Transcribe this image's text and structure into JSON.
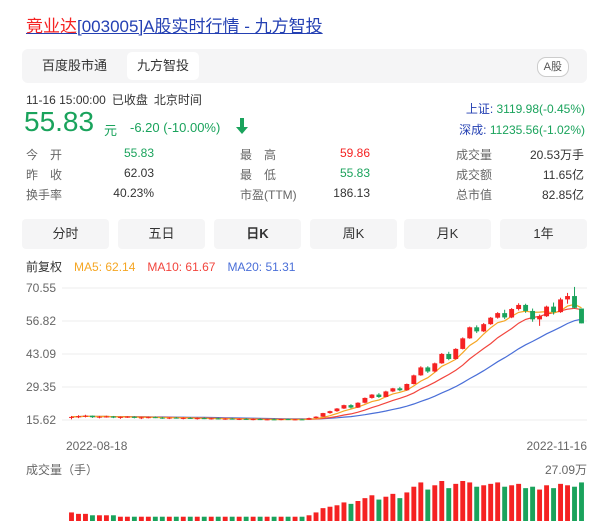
{
  "title": {
    "company": "竟业达",
    "rest": "[003005]A股实时行情 - 九方智投"
  },
  "tabs": [
    {
      "label": "百度股市通"
    },
    {
      "label": "九方智投"
    }
  ],
  "badge": "A股",
  "meta": {
    "datetime": "11-16 15:00:00",
    "status": "已收盘",
    "tz": "北京时间"
  },
  "quote": {
    "price": "55.83",
    "unit": "元",
    "change": "-6.20 (-10.00%)"
  },
  "indices": [
    {
      "name": "上证:",
      "value": "3119.98(-0.45%)"
    },
    {
      "name": "深成:",
      "value": "11235.56(-1.02%)"
    }
  ],
  "stats": {
    "open_label": "今　开",
    "open": "55.83",
    "prev_label": "昨　收",
    "prev": "62.03",
    "turnover_label": "换手率",
    "turnover": "40.23%",
    "high_label": "最　高",
    "high": "59.86",
    "low_label": "最　低",
    "low": "55.83",
    "pe_label": "市盈(TTM)",
    "pe": "186.13",
    "vol_label": "成交量",
    "vol": "20.53万手",
    "amt_label": "成交额",
    "amt": "11.65亿",
    "mcap_label": "总市值",
    "mcap": "82.85亿"
  },
  "periods": [
    "分时",
    "五日",
    "日K",
    "周K",
    "月K",
    "1年"
  ],
  "active_period": 2,
  "legend": {
    "adj": "前复权",
    "ma5": "MA5: 62.14",
    "ma10": "MA10: 61.67",
    "ma20": "MA20: 51.31"
  },
  "colors": {
    "up": "#f52222",
    "down": "#1aa35c",
    "ma5": "#f5a623",
    "ma10": "#f2453d",
    "ma20": "#4a6fd8",
    "link": "#2440b3"
  },
  "chart_data": {
    "type": "candlestick",
    "y_ticks": [
      "70.55",
      "56.82",
      "43.09",
      "29.35",
      "15.62"
    ],
    "ylim": [
      15.62,
      70.55
    ],
    "x_labels": [
      "2022-08-18",
      "2022-11-16"
    ],
    "volume_label": "成交量（手）",
    "volume_max": "27.09万",
    "candles": [
      [
        16.6,
        17.3,
        15.9,
        16.9
      ],
      [
        16.9,
        17.6,
        16.4,
        17.2
      ],
      [
        17.2,
        17.8,
        16.7,
        17.4
      ],
      [
        17.4,
        17.5,
        16.5,
        16.8
      ],
      [
        16.8,
        17.3,
        16.3,
        17.0
      ],
      [
        17.0,
        17.4,
        16.6,
        17.1
      ],
      [
        17.1,
        17.3,
        16.4,
        16.6
      ],
      [
        16.6,
        17.0,
        16.1,
        16.9
      ],
      [
        16.9,
        17.2,
        16.5,
        17.0
      ],
      [
        17.0,
        17.2,
        16.3,
        16.5
      ],
      [
        16.5,
        16.9,
        16.0,
        16.7
      ],
      [
        16.7,
        17.0,
        16.3,
        16.8
      ],
      [
        16.8,
        17.1,
        16.4,
        16.6
      ],
      [
        16.6,
        16.9,
        16.1,
        16.4
      ],
      [
        16.4,
        16.8,
        16.0,
        16.6
      ],
      [
        16.6,
        16.9,
        16.2,
        16.3
      ],
      [
        16.3,
        16.7,
        15.9,
        16.5
      ],
      [
        16.5,
        16.8,
        16.1,
        16.2
      ],
      [
        16.2,
        16.6,
        15.8,
        16.4
      ],
      [
        16.4,
        16.7,
        16.0,
        16.1
      ],
      [
        16.1,
        16.5,
        15.8,
        16.3
      ],
      [
        16.3,
        16.6,
        15.9,
        16.0
      ],
      [
        16.0,
        16.4,
        15.7,
        16.2
      ],
      [
        16.2,
        16.5,
        15.8,
        15.9
      ],
      [
        15.9,
        16.3,
        15.6,
        16.1
      ],
      [
        16.1,
        16.4,
        15.7,
        15.8
      ],
      [
        15.8,
        16.2,
        15.5,
        16.0
      ],
      [
        16.0,
        16.3,
        15.6,
        15.7
      ],
      [
        15.7,
        16.1,
        15.5,
        15.9
      ],
      [
        15.9,
        16.2,
        15.6,
        15.8
      ],
      [
        15.8,
        16.1,
        15.5,
        16.0
      ],
      [
        16.0,
        16.2,
        15.6,
        15.7
      ],
      [
        15.7,
        16.0,
        15.5,
        15.9
      ],
      [
        15.9,
        16.1,
        15.6,
        15.8
      ],
      [
        15.8,
        16.6,
        15.7,
        16.4
      ],
      [
        16.4,
        17.2,
        16.2,
        17.0
      ],
      [
        17.0,
        18.6,
        16.9,
        18.5
      ],
      [
        18.5,
        19.5,
        18.2,
        19.3
      ],
      [
        19.3,
        20.6,
        19.0,
        20.4
      ],
      [
        20.4,
        22.0,
        20.2,
        21.8
      ],
      [
        21.8,
        22.2,
        20.4,
        20.8
      ],
      [
        20.8,
        23.0,
        20.6,
        22.8
      ],
      [
        22.8,
        25.0,
        22.5,
        24.8
      ],
      [
        24.8,
        26.4,
        24.5,
        26.2
      ],
      [
        26.2,
        26.8,
        24.8,
        25.2
      ],
      [
        25.2,
        27.8,
        25.0,
        27.5
      ],
      [
        27.5,
        29.0,
        27.2,
        28.8
      ],
      [
        28.8,
        29.4,
        27.6,
        28.0
      ],
      [
        28.0,
        30.8,
        27.8,
        30.6
      ],
      [
        30.6,
        34.5,
        30.4,
        34.2
      ],
      [
        34.2,
        38.0,
        34.0,
        37.5
      ],
      [
        37.5,
        38.0,
        35.2,
        35.8
      ],
      [
        35.8,
        39.5,
        35.5,
        39.2
      ],
      [
        39.2,
        43.5,
        39.0,
        43.1
      ],
      [
        43.1,
        44.0,
        40.5,
        41.0
      ],
      [
        41.0,
        45.5,
        40.8,
        45.2
      ],
      [
        45.2,
        50.0,
        45.0,
        49.6
      ],
      [
        49.6,
        54.5,
        49.4,
        54.2
      ],
      [
        54.2,
        55.0,
        51.8,
        52.5
      ],
      [
        52.5,
        56.0,
        52.2,
        55.5
      ],
      [
        55.5,
        58.5,
        55.2,
        58.2
      ],
      [
        58.2,
        60.5,
        57.8,
        60.1
      ],
      [
        60.1,
        61.5,
        57.6,
        58.3
      ],
      [
        58.3,
        62.2,
        58.0,
        61.8
      ],
      [
        61.8,
        64.2,
        61.2,
        63.5
      ],
      [
        63.5,
        64.0,
        60.2,
        61.0
      ],
      [
        61.0,
        62.0,
        56.5,
        57.5
      ],
      [
        57.5,
        59.5,
        54.8,
        58.8
      ],
      [
        58.8,
        63.2,
        58.5,
        62.8
      ],
      [
        62.8,
        64.5,
        59.5,
        60.5
      ],
      [
        60.5,
        66.5,
        60.2,
        65.8
      ],
      [
        65.8,
        68.5,
        64.0,
        67.2
      ],
      [
        67.2,
        71.0,
        62.0,
        62.3
      ],
      [
        62.0,
        62.03,
        55.83,
        55.83
      ]
    ],
    "volumes": [
      6,
      5,
      5,
      4,
      4,
      4,
      4,
      3,
      3,
      3,
      3,
      3,
      3,
      3,
      3,
      3,
      3,
      3,
      3,
      3,
      3,
      3,
      3,
      3,
      3,
      3,
      3,
      3,
      3,
      3,
      3,
      3,
      3,
      3,
      4,
      6,
      9,
      10,
      11,
      13,
      12,
      14,
      16,
      18,
      15,
      17,
      19,
      16,
      20,
      24,
      27,
      22,
      25,
      28,
      23,
      26,
      28,
      27,
      24,
      25,
      26,
      27,
      24,
      25,
      26,
      23,
      24,
      22,
      25,
      23,
      26,
      25,
      24,
      27
    ]
  }
}
